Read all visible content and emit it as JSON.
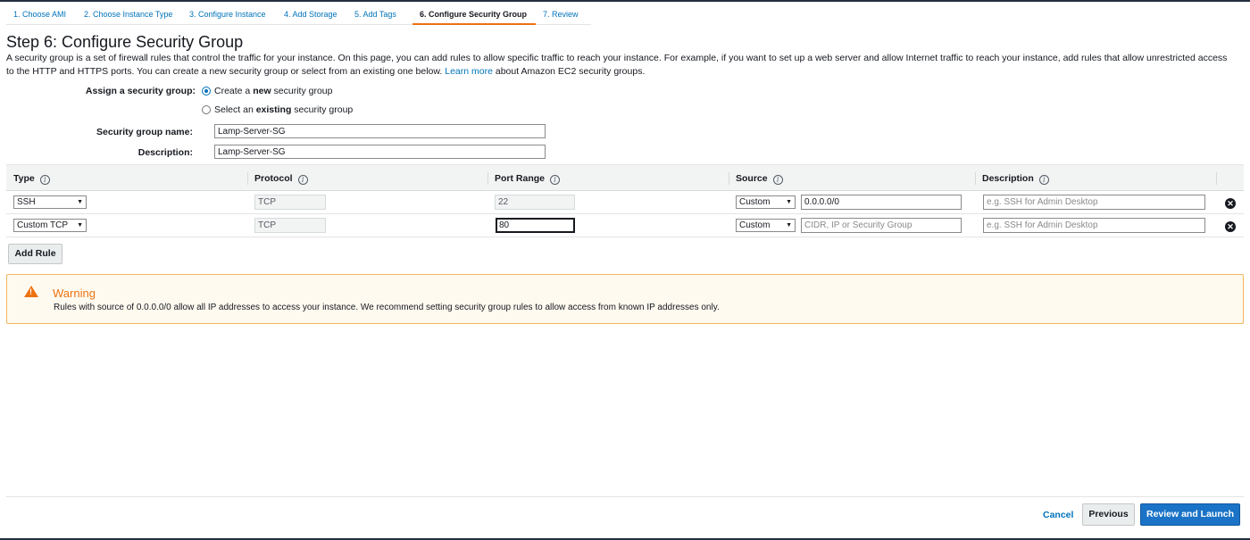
{
  "wizard": {
    "steps": [
      {
        "label": "1. Choose AMI"
      },
      {
        "label": "2. Choose Instance Type"
      },
      {
        "label": "3. Configure Instance"
      },
      {
        "label": "4. Add Storage"
      },
      {
        "label": "5. Add Tags"
      },
      {
        "label": "6. Configure Security Group",
        "active": true
      },
      {
        "label": "7. Review"
      }
    ]
  },
  "page": {
    "title": "Step 6: Configure Security Group",
    "intro_text": "A security group is a set of firewall rules that control the traffic for your instance. On this page, you can add rules to allow specific traffic to reach your instance. For example, if you want to set up a web server and allow Internet traffic to reach your instance, add rules that allow unrestricted access to the HTTP and HTTPS ports. You can create a new security group or select from an existing one below.",
    "learn_more_label": "Learn more",
    "learn_more_suffix": "about Amazon EC2 security groups."
  },
  "assign": {
    "label": "Assign a security group:",
    "option_new": {
      "prefix": "Create a ",
      "bold": "new",
      "suffix": " security group",
      "checked": true
    },
    "option_existing": {
      "prefix": "Select an ",
      "bold": "existing",
      "suffix": " security group",
      "checked": false
    }
  },
  "group": {
    "name_label": "Security group name:",
    "name_value": "Lamp-Server-SG",
    "description_label": "Description:",
    "description_value": "Lamp-Server-SG"
  },
  "table": {
    "columns": [
      "Type",
      "Protocol",
      "Port Range",
      "Source",
      "Description"
    ],
    "rows": [
      {
        "type": "SSH",
        "protocol": "TCP",
        "port_range": "22",
        "source_type": "Custom",
        "source_value": "0.0.0.0/0",
        "source_placeholder": "",
        "description_placeholder": "e.g. SSH for Admin Desktop"
      },
      {
        "type": "Custom TCP",
        "protocol": "TCP",
        "port_range": "80",
        "source_type": "Custom",
        "source_value": "",
        "source_placeholder": "CIDR, IP or Security Group",
        "description_placeholder": "e.g. SSH for Admin Desktop"
      }
    ],
    "add_rule_label": "Add Rule"
  },
  "warning": {
    "title": "Warning",
    "text": "Rules with source of 0.0.0.0/0 allow all IP addresses to access your instance. We recommend setting security group rules to allow access from known IP addresses only.",
    "color": "#ec7211"
  },
  "footer": {
    "cancel_label": "Cancel",
    "previous_label": "Previous",
    "primary_label": "Review and Launch"
  },
  "icons": {
    "info": "info-icon",
    "remove": "remove-rule-icon",
    "warning": "warning-triangle-icon",
    "chevron": "chevron-down-icon"
  },
  "colors": {
    "accent": "#0073bb",
    "primary_button": "#1a73c6",
    "active_tab_underline": "#ec7211"
  }
}
